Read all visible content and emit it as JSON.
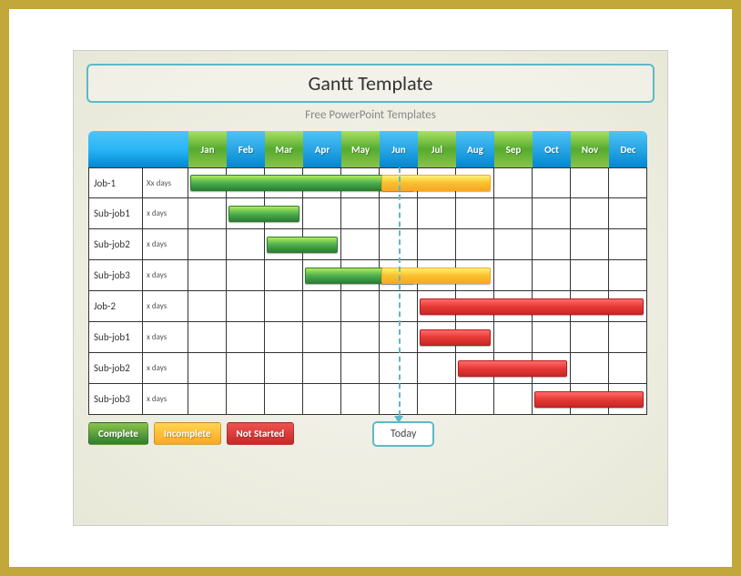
{
  "title": "Gantt Template",
  "subtitle": "Free PowerPoint Templates",
  "months": [
    "Jan",
    "Feb",
    "Mar",
    "Apr",
    "May",
    "Jun",
    "Jul",
    "Aug",
    "Sep",
    "Oct",
    "Nov",
    "Dec"
  ],
  "rows": [
    {
      "label": "Job-1",
      "dur": "Xx days"
    },
    {
      "label": "Sub-job1",
      "dur": "x days"
    },
    {
      "label": "Sub-job2",
      "dur": "x days"
    },
    {
      "label": "Sub-job3",
      "dur": "x days"
    },
    {
      "label": "Job-2",
      "dur": "x days"
    },
    {
      "label": "Sub-job1",
      "dur": "x days"
    },
    {
      "label": "Sub-job2",
      "dur": "x days"
    },
    {
      "label": "Sub-job3",
      "dur": "x days"
    }
  ],
  "legend": {
    "complete": "Complete",
    "incomplete": "Incomplete",
    "notstarted": "Not Started"
  },
  "today_label": "Today",
  "chart_data": {
    "type": "bar",
    "title": "Gantt Template",
    "xlabel": "",
    "ylabel": "",
    "categories": [
      "Jan",
      "Feb",
      "Mar",
      "Apr",
      "May",
      "Jun",
      "Jul",
      "Aug",
      "Sep",
      "Oct",
      "Nov",
      "Dec"
    ],
    "today_marker": "Jun",
    "series": [
      {
        "name": "Job-1",
        "duration": "Xx days",
        "segments": [
          {
            "start": "Jan",
            "end": "Jun",
            "status": "Complete"
          },
          {
            "start": "Jun",
            "end": "Aug",
            "status": "Incomplete"
          }
        ]
      },
      {
        "name": "Sub-job1",
        "duration": "x days",
        "segments": [
          {
            "start": "Feb",
            "end": "Mar",
            "status": "Complete"
          }
        ]
      },
      {
        "name": "Sub-job2",
        "duration": "x days",
        "segments": [
          {
            "start": "Mar",
            "end": "Apr",
            "status": "Complete"
          }
        ]
      },
      {
        "name": "Sub-job3",
        "duration": "x days",
        "segments": [
          {
            "start": "Apr",
            "end": "Jun",
            "status": "Complete"
          },
          {
            "start": "Jun",
            "end": "Aug",
            "status": "Incomplete"
          }
        ]
      },
      {
        "name": "Job-2",
        "duration": "x days",
        "segments": [
          {
            "start": "Jul",
            "end": "Dec",
            "status": "Not Started"
          }
        ]
      },
      {
        "name": "Sub-job1",
        "duration": "x days",
        "segments": [
          {
            "start": "Jul",
            "end": "Aug",
            "status": "Not Started"
          }
        ]
      },
      {
        "name": "Sub-job2",
        "duration": "x days",
        "segments": [
          {
            "start": "Aug",
            "end": "Oct",
            "status": "Not Started"
          }
        ]
      },
      {
        "name": "Sub-job3",
        "duration": "x days",
        "segments": [
          {
            "start": "Oct",
            "end": "Dec",
            "status": "Not Started"
          }
        ]
      }
    ],
    "legend_items": [
      "Complete",
      "Incomplete",
      "Not Started"
    ]
  }
}
